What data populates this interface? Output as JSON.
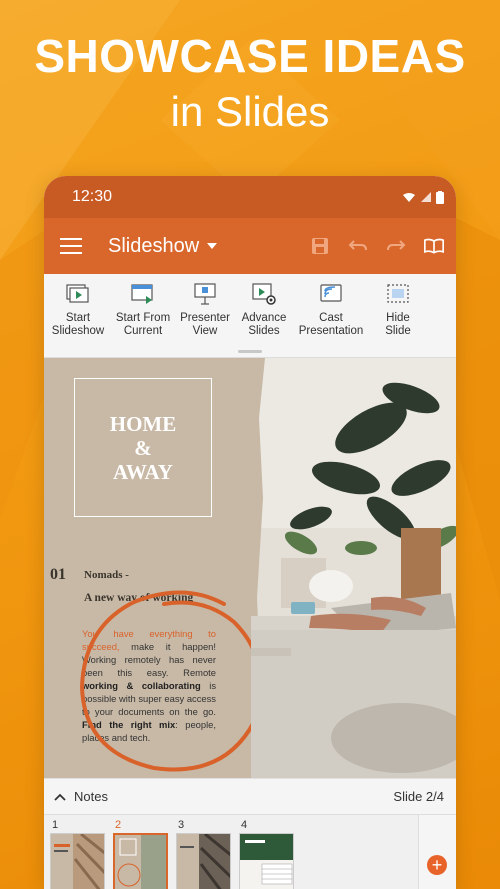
{
  "hero": {
    "title": "SHOWCASE IDEAS",
    "subtitle": "in Slides"
  },
  "status_bar": {
    "time": "12:30",
    "icons": [
      "wifi-icon",
      "signal-icon",
      "battery-icon"
    ]
  },
  "app_bar": {
    "title": "Slideshow",
    "actions": [
      "save-icon",
      "undo-icon",
      "redo-icon",
      "read-mode-icon"
    ]
  },
  "ribbon": {
    "buttons": [
      {
        "label_1": "Start",
        "label_2": "Slideshow",
        "icon": "start-slideshow-icon"
      },
      {
        "label_1": "Start From",
        "label_2": "Current",
        "icon": "start-from-current-icon"
      },
      {
        "label_1": "Presenter",
        "label_2": "View",
        "icon": "presenter-view-icon"
      },
      {
        "label_1": "Advance",
        "label_2": "Slides",
        "icon": "advance-slides-icon"
      },
      {
        "label_1": "Cast",
        "label_2": "Presentation",
        "icon": "cast-icon"
      },
      {
        "label_1": "Hide",
        "label_2": "Slide",
        "icon": "hide-slide-icon"
      }
    ]
  },
  "slide": {
    "title_line1": "HOME",
    "title_line2": "&",
    "title_line3": "AWAY",
    "number": "01",
    "heading": "Nomads -",
    "tagline": "A new way of working",
    "body": {
      "highlight": "You have everything to succeed,",
      "part1": " make it happen! Working remotely has never been this easy. Remote ",
      "bold1": "working & collaborating",
      "part2": " is possible with super easy access to your documents on the go. ",
      "bold2": "Find the right mix",
      "part3": ": people, places and tech."
    },
    "accent_color": "#d9622b"
  },
  "notes_bar": {
    "label": "Notes",
    "slide_indicator": "Slide 2/4"
  },
  "thumbnails": {
    "items": [
      {
        "number": "1",
        "active": false
      },
      {
        "number": "2",
        "active": true
      },
      {
        "number": "3",
        "active": false
      },
      {
        "number": "4",
        "active": false
      }
    ],
    "add_label": "+"
  },
  "colors": {
    "app_bar": "#d9672b",
    "status_bar": "#c85a24",
    "background": "#f29a12"
  }
}
